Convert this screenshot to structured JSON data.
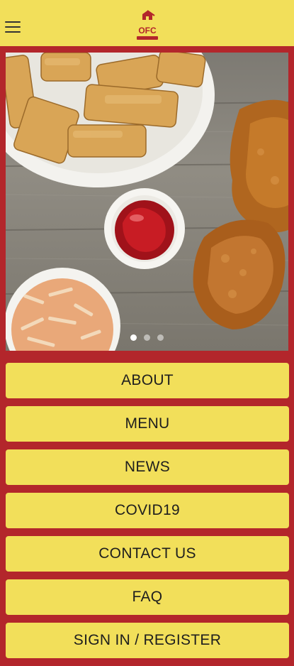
{
  "header": {
    "menu_icon": "hamburger-icon",
    "logo_text": "OFC",
    "brand_color": "#f2df5a",
    "accent_color": "#b3262b"
  },
  "hero": {
    "slide_count": 3,
    "active_slide": 1
  },
  "nav": {
    "items": [
      {
        "label": "ABOUT"
      },
      {
        "label": "MENU"
      },
      {
        "label": "NEWS"
      },
      {
        "label": "COVID19"
      },
      {
        "label": "CONTACT US"
      },
      {
        "label": "FAQ"
      },
      {
        "label": "SIGN IN / REGISTER"
      }
    ]
  }
}
